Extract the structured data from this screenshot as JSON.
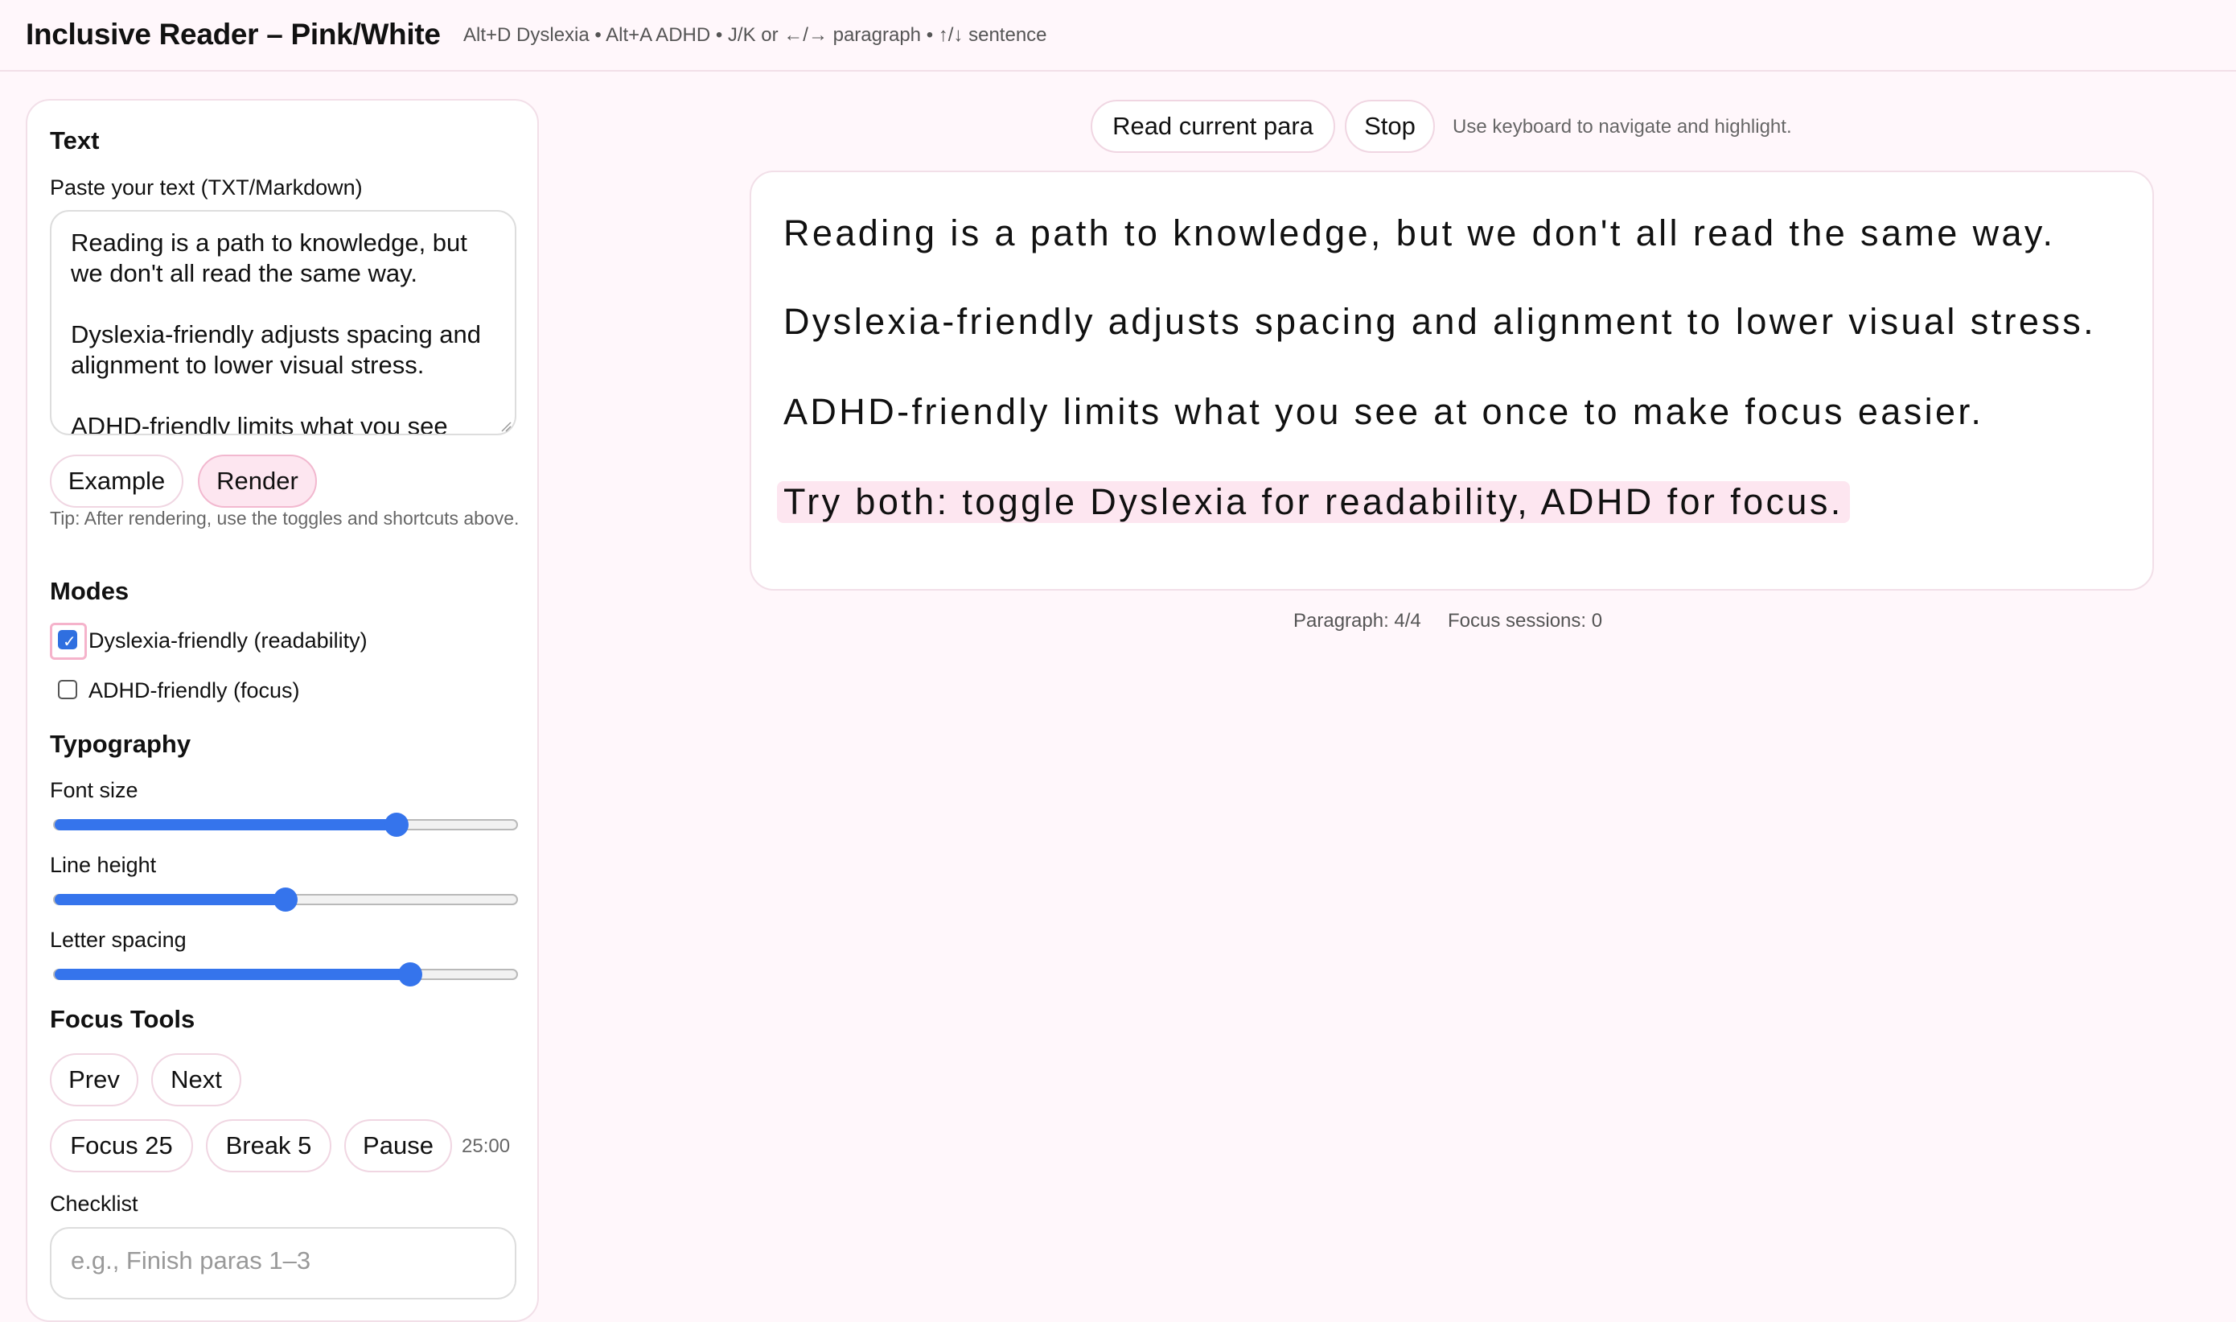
{
  "header": {
    "title": "Inclusive Reader – Pink/White",
    "shortcuts": "Alt+D Dyslexia • Alt+A ADHD • J/K or ←/→ paragraph • ↑/↓ sentence"
  },
  "sidebar": {
    "text_section": {
      "title": "Text",
      "paste_label": "Paste your text (TXT/Markdown)",
      "textarea_value": "Reading is a path to knowledge, but we don't all read the same way.\n\nDyslexia-friendly adjusts spacing and alignment to lower visual stress.\n\nADHD-friendly limits what you see",
      "example_button": "Example",
      "render_button": "Render",
      "tip": "Tip: After rendering, use the toggles and shortcuts above."
    },
    "modes": {
      "title": "Modes",
      "dyslexia": {
        "label": "Dyslexia-friendly (readability)",
        "checked": true
      },
      "adhd": {
        "label": "ADHD-friendly (focus)",
        "checked": false
      }
    },
    "typography": {
      "title": "Typography",
      "font_size": {
        "label": "Font size",
        "value": 0.74
      },
      "line_height": {
        "label": "Line height",
        "value": 0.5
      },
      "letter_spacing": {
        "label": "Letter spacing",
        "value": 0.77
      }
    },
    "focus_tools": {
      "title": "Focus Tools",
      "prev_button": "Prev",
      "next_button": "Next",
      "focus_button": "Focus 25",
      "break_button": "Break 5",
      "pause_button": "Pause",
      "timer": "25:00",
      "checklist_label": "Checklist",
      "checklist_placeholder": "e.g., Finish paras 1–3"
    }
  },
  "main": {
    "read_button": "Read current para",
    "stop_button": "Stop",
    "hint": "Use keyboard to navigate and highlight.",
    "paragraphs": [
      "Reading is a path to knowledge, but we don't all read the same way.",
      "Dyslexia-friendly adjusts spacing and alignment to lower visual stress.",
      "ADHD-friendly limits what you see at once to make focus easier.",
      "Try both: toggle Dyslexia for readability, ADHD for focus."
    ],
    "active_paragraph": 4,
    "status": {
      "paragraph": "Paragraph: 4/4",
      "sessions": "Focus sessions: 0"
    }
  },
  "colors": {
    "background": "#fff7fb",
    "accent_pink": "#fde6f0",
    "slider_blue": "#3574ec"
  }
}
